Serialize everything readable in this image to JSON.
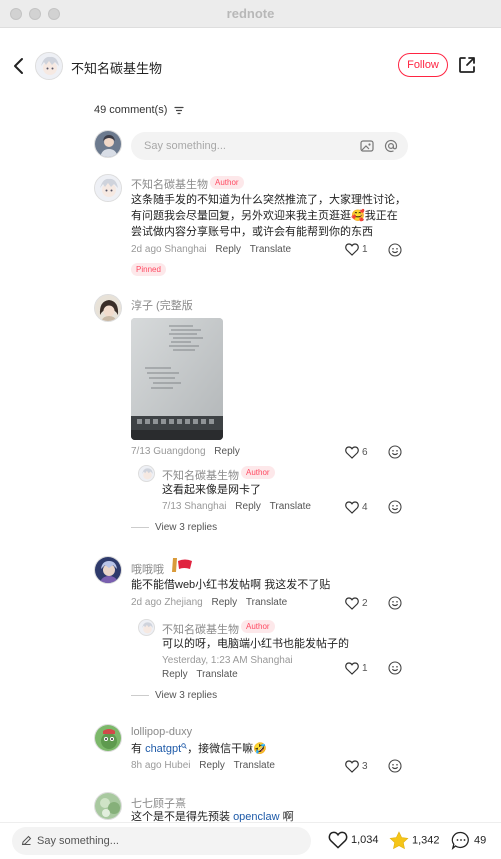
{
  "window": {
    "title": "rednote"
  },
  "header": {
    "author_name": "不知名碳基生物",
    "follow_label": "Follow"
  },
  "comments_section": {
    "count_label": "49 comment(s)",
    "input_placeholder": "Say something..."
  },
  "comments": [
    {
      "username": "不知名碳基生物",
      "badge": "Author",
      "text_lines": [
        "这条随手发的不知道为什么突然推流了，大家理性讨论，",
        "有问题我会尽量回复，另外欢迎来我主页逛逛🥰我正在",
        "尝试做内容分享账号中，或许会有能帮到你的东西"
      ],
      "time_location": "2d ago Shanghai",
      "reply_label": "Reply",
      "translate_label": "Translate",
      "likes": "1",
      "pinned_label": "Pinned"
    },
    {
      "username": "淳子 (完整版",
      "time_location": "7/13 Guangdong",
      "reply_label": "Reply",
      "likes": "6",
      "replies": [
        {
          "username": "不知名碳基生物",
          "badge": "Author",
          "text": "这看起来像是网卡了",
          "time_location": "7/13 Shanghai",
          "reply_label": "Reply",
          "translate_label": "Translate",
          "likes": "4"
        }
      ],
      "view_replies_label": "View 3 replies"
    },
    {
      "username": "哦哦哦",
      "text": "能不能借web小红书发帖啊 我这发不了贴",
      "time_location": "2d ago Zhejiang",
      "reply_label": "Reply",
      "translate_label": "Translate",
      "likes": "2",
      "replies": [
        {
          "username": "不知名碳基生物",
          "badge": "Author",
          "text": "可以的呀，电脑端小红书也能发帖子的",
          "time_location": "Yesterday, 1:23 AM Shanghai",
          "reply_label": "Reply",
          "translate_label": "Translate",
          "likes": "1"
        }
      ],
      "view_replies_label": "View 3 replies"
    },
    {
      "username": "lollipop-duxy",
      "text_prefix": "有 ",
      "text_link": "chatgpt",
      "text_suffix": "，接微信干嘛🤣",
      "time_location": "8h ago Hubei",
      "reply_label": "Reply",
      "translate_label": "Translate",
      "likes": "3"
    },
    {
      "username": "七七顾子熹",
      "text_prefix": "这个是不是得先预装 ",
      "text_link": "openclaw",
      "text_suffix": " 啊"
    }
  ],
  "bottom_bar": {
    "input_placeholder": "Say something...",
    "likes": "1,034",
    "collects": "1,342",
    "comments": "49"
  },
  "colors": {
    "brand_red": "#ff2442",
    "tag_bg": "#fde8ea",
    "link_blue": "#1e5aa8",
    "star_gold": "#f5c518"
  },
  "icons": [
    "back-icon",
    "share-icon",
    "sort-icon",
    "image-icon",
    "mention-icon",
    "heart-icon",
    "smile-icon",
    "pencil-icon",
    "star-icon",
    "comment-icon",
    "search-link-icon"
  ]
}
